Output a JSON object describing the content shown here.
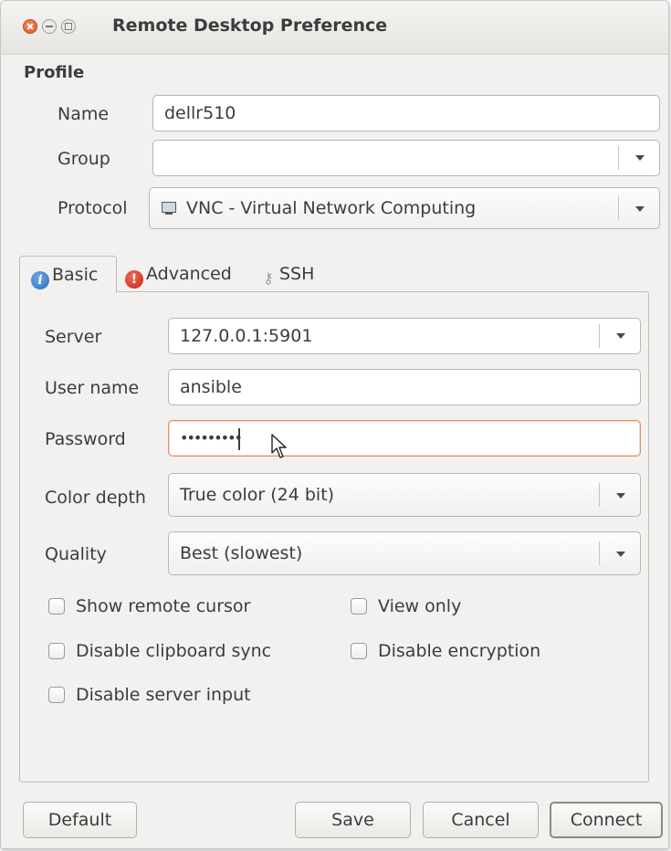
{
  "window": {
    "title": "Remote Desktop Preference"
  },
  "profile": {
    "section_title": "Profile",
    "name_label": "Name",
    "name_value": "dellr510",
    "group_label": "Group",
    "group_value": "",
    "protocol_label": "Protocol",
    "protocol_value": "VNC - Virtual Network Computing",
    "protocol_icon": "screen-icon"
  },
  "tabs": [
    {
      "label": "Basic",
      "icon": "info-icon",
      "active": true
    },
    {
      "label": "Advanced",
      "icon": "warning-icon",
      "active": false
    },
    {
      "label": "SSH",
      "icon": "key-icon",
      "active": false
    }
  ],
  "basic": {
    "server_label": "Server",
    "server_value": "127.0.0.1:5901",
    "username_label": "User name",
    "username_value": "ansible",
    "password_label": "Password",
    "password_value": "•••••••••",
    "color_depth_label": "Color depth",
    "color_depth_value": "True color (24 bit)",
    "quality_label": "Quality",
    "quality_value": "Best (slowest)",
    "checkboxes": [
      {
        "label": "Show remote cursor",
        "checked": false
      },
      {
        "label": "View only",
        "checked": false
      },
      {
        "label": "Disable clipboard sync",
        "checked": false
      },
      {
        "label": "Disable encryption",
        "checked": false
      },
      {
        "label": "Disable server input",
        "checked": false
      }
    ]
  },
  "buttons": {
    "default": "Default",
    "save": "Save",
    "cancel": "Cancel",
    "connect": "Connect"
  },
  "colors": {
    "focus_border": "#e68c5e",
    "close_button": "#e05428",
    "window_bg": "#f2f1f0"
  }
}
